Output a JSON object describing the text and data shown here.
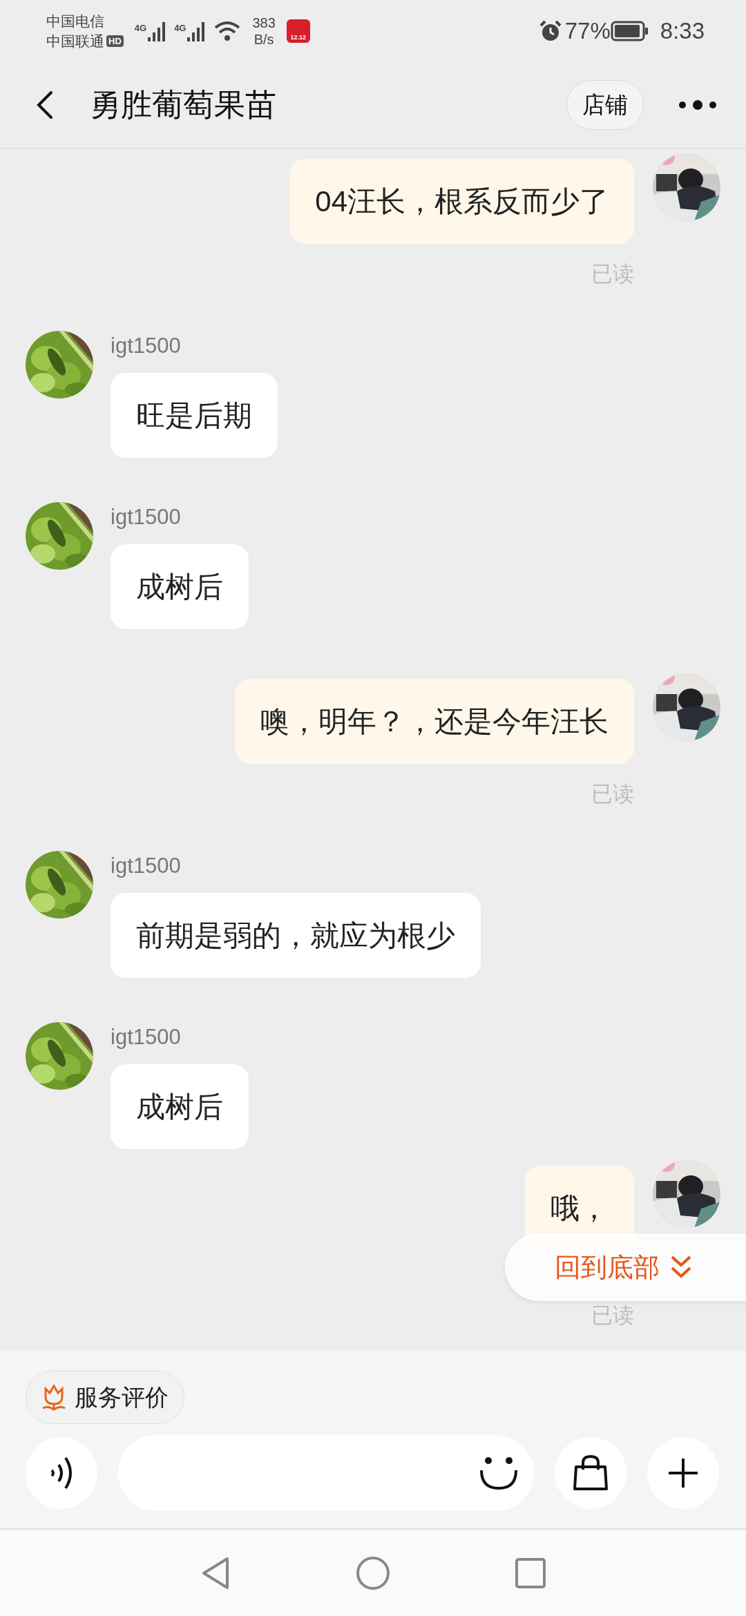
{
  "status_bar": {
    "carrier_1": "中国电信",
    "carrier_2": "中国联通",
    "hd_badge": "HD",
    "network_1": "4G",
    "network_2": "4G",
    "net_speed": "383",
    "net_speed_unit": "B/s",
    "app_icon_label": "12.12",
    "battery_percent": "77%",
    "time": "8:33"
  },
  "header": {
    "title": "勇胜葡萄果苗",
    "shop_button": "店铺"
  },
  "messages": [
    {
      "kind": "outgoing",
      "text": "04汪长，根系反而少了",
      "read_receipt": "已读"
    },
    {
      "kind": "incoming",
      "sender": "igt1500",
      "text": "旺是后期"
    },
    {
      "kind": "incoming",
      "sender": "igt1500",
      "text": "成树后"
    },
    {
      "kind": "outgoing",
      "text": "噢，明年？，还是今年汪长",
      "read_receipt": "已读"
    },
    {
      "kind": "incoming",
      "sender": "igt1500",
      "text": "前期是弱的，就应为根少"
    },
    {
      "kind": "incoming",
      "sender": "igt1500",
      "text": "成树后"
    },
    {
      "kind": "outgoing",
      "text": "哦，",
      "read_receipt": "已读"
    }
  ],
  "scroll_to_bottom": {
    "label": "回到底部"
  },
  "service_rating": {
    "label": "服务评价"
  }
}
